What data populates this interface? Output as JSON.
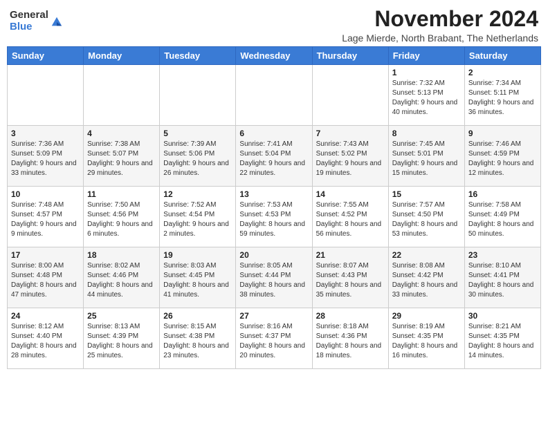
{
  "logo": {
    "general": "General",
    "blue": "Blue"
  },
  "title": "November 2024",
  "location": "Lage Mierde, North Brabant, The Netherlands",
  "days_of_week": [
    "Sunday",
    "Monday",
    "Tuesday",
    "Wednesday",
    "Thursday",
    "Friday",
    "Saturday"
  ],
  "weeks": [
    [
      {
        "day": "",
        "info": ""
      },
      {
        "day": "",
        "info": ""
      },
      {
        "day": "",
        "info": ""
      },
      {
        "day": "",
        "info": ""
      },
      {
        "day": "",
        "info": ""
      },
      {
        "day": "1",
        "info": "Sunrise: 7:32 AM\nSunset: 5:13 PM\nDaylight: 9 hours\nand 40 minutes."
      },
      {
        "day": "2",
        "info": "Sunrise: 7:34 AM\nSunset: 5:11 PM\nDaylight: 9 hours\nand 36 minutes."
      }
    ],
    [
      {
        "day": "3",
        "info": "Sunrise: 7:36 AM\nSunset: 5:09 PM\nDaylight: 9 hours\nand 33 minutes."
      },
      {
        "day": "4",
        "info": "Sunrise: 7:38 AM\nSunset: 5:07 PM\nDaylight: 9 hours\nand 29 minutes."
      },
      {
        "day": "5",
        "info": "Sunrise: 7:39 AM\nSunset: 5:06 PM\nDaylight: 9 hours\nand 26 minutes."
      },
      {
        "day": "6",
        "info": "Sunrise: 7:41 AM\nSunset: 5:04 PM\nDaylight: 9 hours\nand 22 minutes."
      },
      {
        "day": "7",
        "info": "Sunrise: 7:43 AM\nSunset: 5:02 PM\nDaylight: 9 hours\nand 19 minutes."
      },
      {
        "day": "8",
        "info": "Sunrise: 7:45 AM\nSunset: 5:01 PM\nDaylight: 9 hours\nand 15 minutes."
      },
      {
        "day": "9",
        "info": "Sunrise: 7:46 AM\nSunset: 4:59 PM\nDaylight: 9 hours\nand 12 minutes."
      }
    ],
    [
      {
        "day": "10",
        "info": "Sunrise: 7:48 AM\nSunset: 4:57 PM\nDaylight: 9 hours\nand 9 minutes."
      },
      {
        "day": "11",
        "info": "Sunrise: 7:50 AM\nSunset: 4:56 PM\nDaylight: 9 hours\nand 6 minutes."
      },
      {
        "day": "12",
        "info": "Sunrise: 7:52 AM\nSunset: 4:54 PM\nDaylight: 9 hours\nand 2 minutes."
      },
      {
        "day": "13",
        "info": "Sunrise: 7:53 AM\nSunset: 4:53 PM\nDaylight: 8 hours\nand 59 minutes."
      },
      {
        "day": "14",
        "info": "Sunrise: 7:55 AM\nSunset: 4:52 PM\nDaylight: 8 hours\nand 56 minutes."
      },
      {
        "day": "15",
        "info": "Sunrise: 7:57 AM\nSunset: 4:50 PM\nDaylight: 8 hours\nand 53 minutes."
      },
      {
        "day": "16",
        "info": "Sunrise: 7:58 AM\nSunset: 4:49 PM\nDaylight: 8 hours\nand 50 minutes."
      }
    ],
    [
      {
        "day": "17",
        "info": "Sunrise: 8:00 AM\nSunset: 4:48 PM\nDaylight: 8 hours\nand 47 minutes."
      },
      {
        "day": "18",
        "info": "Sunrise: 8:02 AM\nSunset: 4:46 PM\nDaylight: 8 hours\nand 44 minutes."
      },
      {
        "day": "19",
        "info": "Sunrise: 8:03 AM\nSunset: 4:45 PM\nDaylight: 8 hours\nand 41 minutes."
      },
      {
        "day": "20",
        "info": "Sunrise: 8:05 AM\nSunset: 4:44 PM\nDaylight: 8 hours\nand 38 minutes."
      },
      {
        "day": "21",
        "info": "Sunrise: 8:07 AM\nSunset: 4:43 PM\nDaylight: 8 hours\nand 35 minutes."
      },
      {
        "day": "22",
        "info": "Sunrise: 8:08 AM\nSunset: 4:42 PM\nDaylight: 8 hours\nand 33 minutes."
      },
      {
        "day": "23",
        "info": "Sunrise: 8:10 AM\nSunset: 4:41 PM\nDaylight: 8 hours\nand 30 minutes."
      }
    ],
    [
      {
        "day": "24",
        "info": "Sunrise: 8:12 AM\nSunset: 4:40 PM\nDaylight: 8 hours\nand 28 minutes."
      },
      {
        "day": "25",
        "info": "Sunrise: 8:13 AM\nSunset: 4:39 PM\nDaylight: 8 hours\nand 25 minutes."
      },
      {
        "day": "26",
        "info": "Sunrise: 8:15 AM\nSunset: 4:38 PM\nDaylight: 8 hours\nand 23 minutes."
      },
      {
        "day": "27",
        "info": "Sunrise: 8:16 AM\nSunset: 4:37 PM\nDaylight: 8 hours\nand 20 minutes."
      },
      {
        "day": "28",
        "info": "Sunrise: 8:18 AM\nSunset: 4:36 PM\nDaylight: 8 hours\nand 18 minutes."
      },
      {
        "day": "29",
        "info": "Sunrise: 8:19 AM\nSunset: 4:35 PM\nDaylight: 8 hours\nand 16 minutes."
      },
      {
        "day": "30",
        "info": "Sunrise: 8:21 AM\nSunset: 4:35 PM\nDaylight: 8 hours\nand 14 minutes."
      }
    ]
  ]
}
